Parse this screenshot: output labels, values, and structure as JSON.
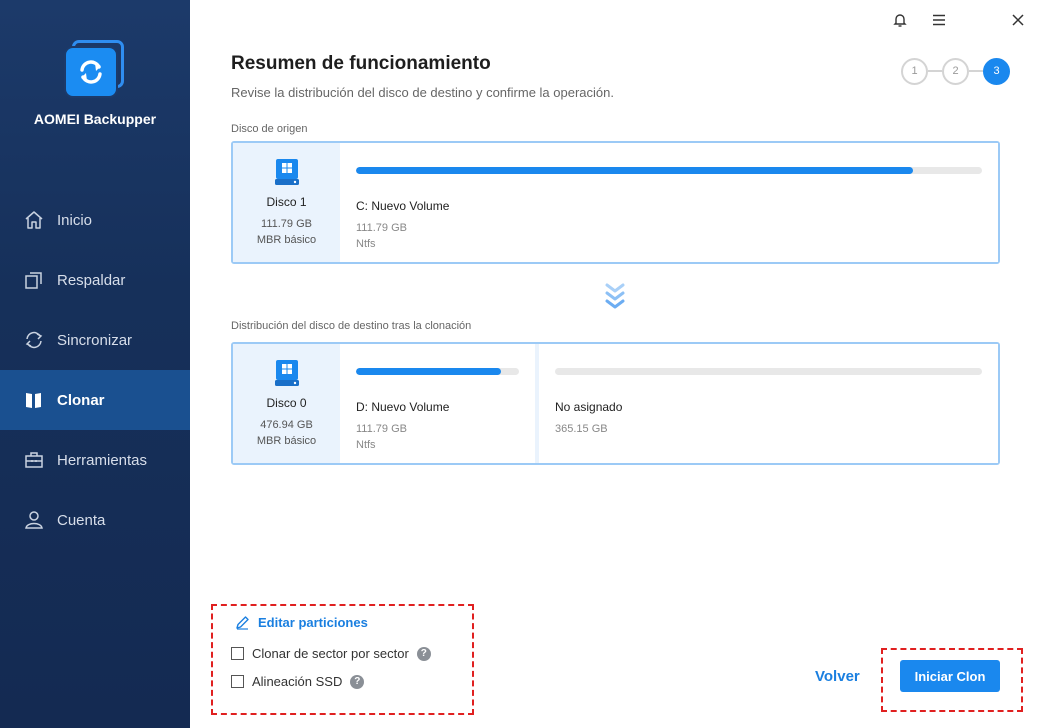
{
  "app": {
    "name": "AOMEI Backupper"
  },
  "nav": [
    {
      "label": "Inicio",
      "icon": "home-icon",
      "active": false
    },
    {
      "label": "Respaldar",
      "icon": "backup-icon",
      "active": false
    },
    {
      "label": "Sincronizar",
      "icon": "sync-icon",
      "active": false
    },
    {
      "label": "Clonar",
      "icon": "clone-icon",
      "active": true
    },
    {
      "label": "Herramientas",
      "icon": "toolbox-icon",
      "active": false
    },
    {
      "label": "Cuenta",
      "icon": "user-icon",
      "active": false
    }
  ],
  "header": {
    "title": "Resumen de funcionamiento",
    "subtitle": "Revise la distribución del disco de destino y confirme la operación."
  },
  "steps": [
    "1",
    "2",
    "3"
  ],
  "current_step": 3,
  "source": {
    "label": "Disco de origen",
    "disk": {
      "name": "Disco 1",
      "size": "111.79 GB",
      "type": "MBR básico"
    },
    "partitions": [
      {
        "name": "C: Nuevo Volume",
        "size": "111.79 GB",
        "fs": "Ntfs",
        "used_fraction": 0.89
      }
    ]
  },
  "destination": {
    "label": "Distribución del disco de destino tras la clonación",
    "disk": {
      "name": "Disco 0",
      "size": "476.94 GB",
      "type": "MBR básico"
    },
    "partitions": [
      {
        "name": "D: Nuevo Volume",
        "size": "111.79 GB",
        "fs": "Ntfs",
        "used_fraction": 0.89
      },
      {
        "name": "No asignado",
        "size": "365.15 GB",
        "fs": "",
        "used_fraction": 0
      }
    ]
  },
  "options": {
    "edit_label": "Editar particiones",
    "sector_label": "Clonar de sector por sector",
    "sector_checked": false,
    "ssd_label": "Alineación SSD",
    "ssd_checked": false,
    "help_glyph": "?"
  },
  "buttons": {
    "back": "Volver",
    "start": "Iniciar Clon"
  },
  "colors": {
    "accent": "#1a88ee",
    "sidebar": "#16305a",
    "highlight_border": "#e02020"
  }
}
